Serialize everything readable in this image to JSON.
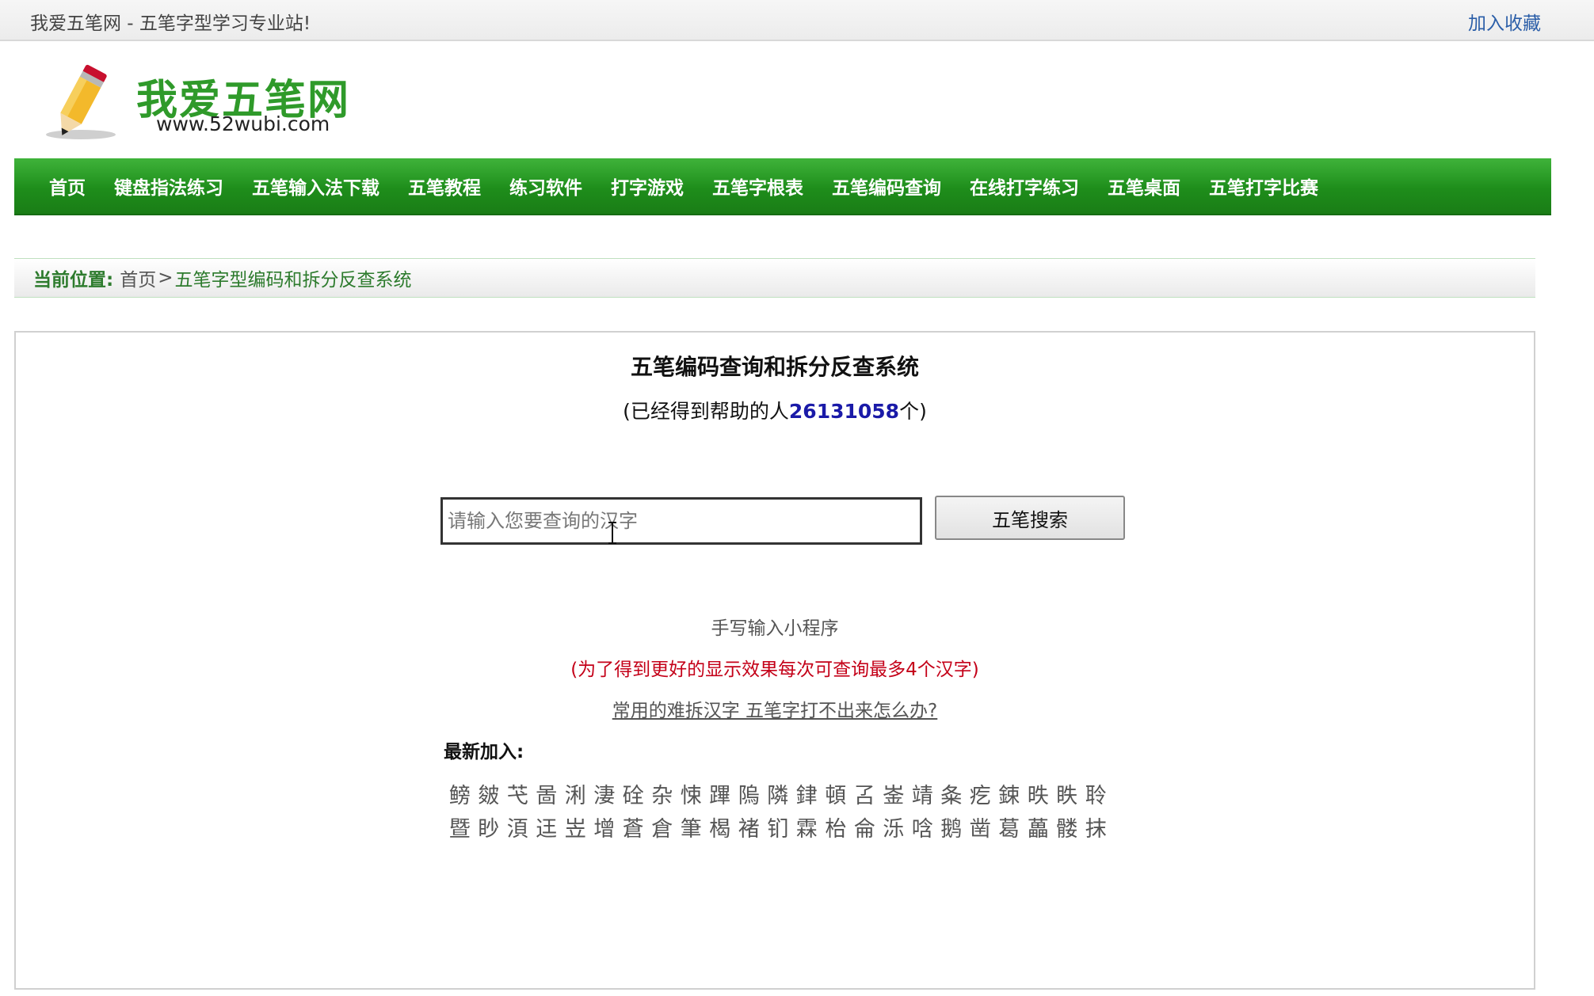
{
  "topbar": {
    "slogan": "我爱五笔网 - 五笔字型学习专业站!",
    "favorite": "加入收藏"
  },
  "logo": {
    "title": "我爱五笔网",
    "url": "www.52wubi.com"
  },
  "nav": [
    "首页",
    "键盘指法练习",
    "五笔输入法下载",
    "五笔教程",
    "练习软件",
    "打字游戏",
    "五笔字根表",
    "五笔编码查询",
    "在线打字练习",
    "五笔桌面",
    "五笔打字比赛"
  ],
  "breadcrumb": {
    "lead": "当前位置:",
    "home": "首页",
    "sep": ">",
    "current": "五笔字型编码和拆分反查系统"
  },
  "main": {
    "title": "五笔编码查询和拆分反查系统",
    "helped_prefix": "(已经得到帮助的人",
    "helped_count": "26131058",
    "helped_suffix": "个)",
    "search_placeholder": "请输入您要查询的汉字",
    "search_button": "五笔搜索",
    "handwrite_link": "手写输入小程序",
    "notice": "(为了得到更好的显示效果每次可查询最多4个汉字)",
    "hard_chars_link": "常用的难拆汉字 五笔字打不出来怎么办?",
    "newest_label": "最新加入:",
    "newest_row1": [
      "鳑",
      "皴",
      "芅",
      "啚",
      "浰",
      "淒",
      "硂",
      "杂",
      "悚",
      "蹕",
      "隖",
      "隣",
      "銉",
      "頓",
      "叾",
      "崟",
      "靖",
      "夈",
      "疙",
      "鋉",
      "昳",
      "眣",
      "聆"
    ],
    "newest_row2": [
      "暨",
      "眇",
      "湏",
      "迋",
      "岦",
      "增",
      "蒼",
      "倉",
      "筆",
      "楬",
      "褚",
      "钔",
      "霖",
      "枱",
      "侖",
      "泺",
      "唅",
      "鹅",
      "凿",
      "葛",
      "藟",
      "髅",
      "抹"
    ]
  }
}
